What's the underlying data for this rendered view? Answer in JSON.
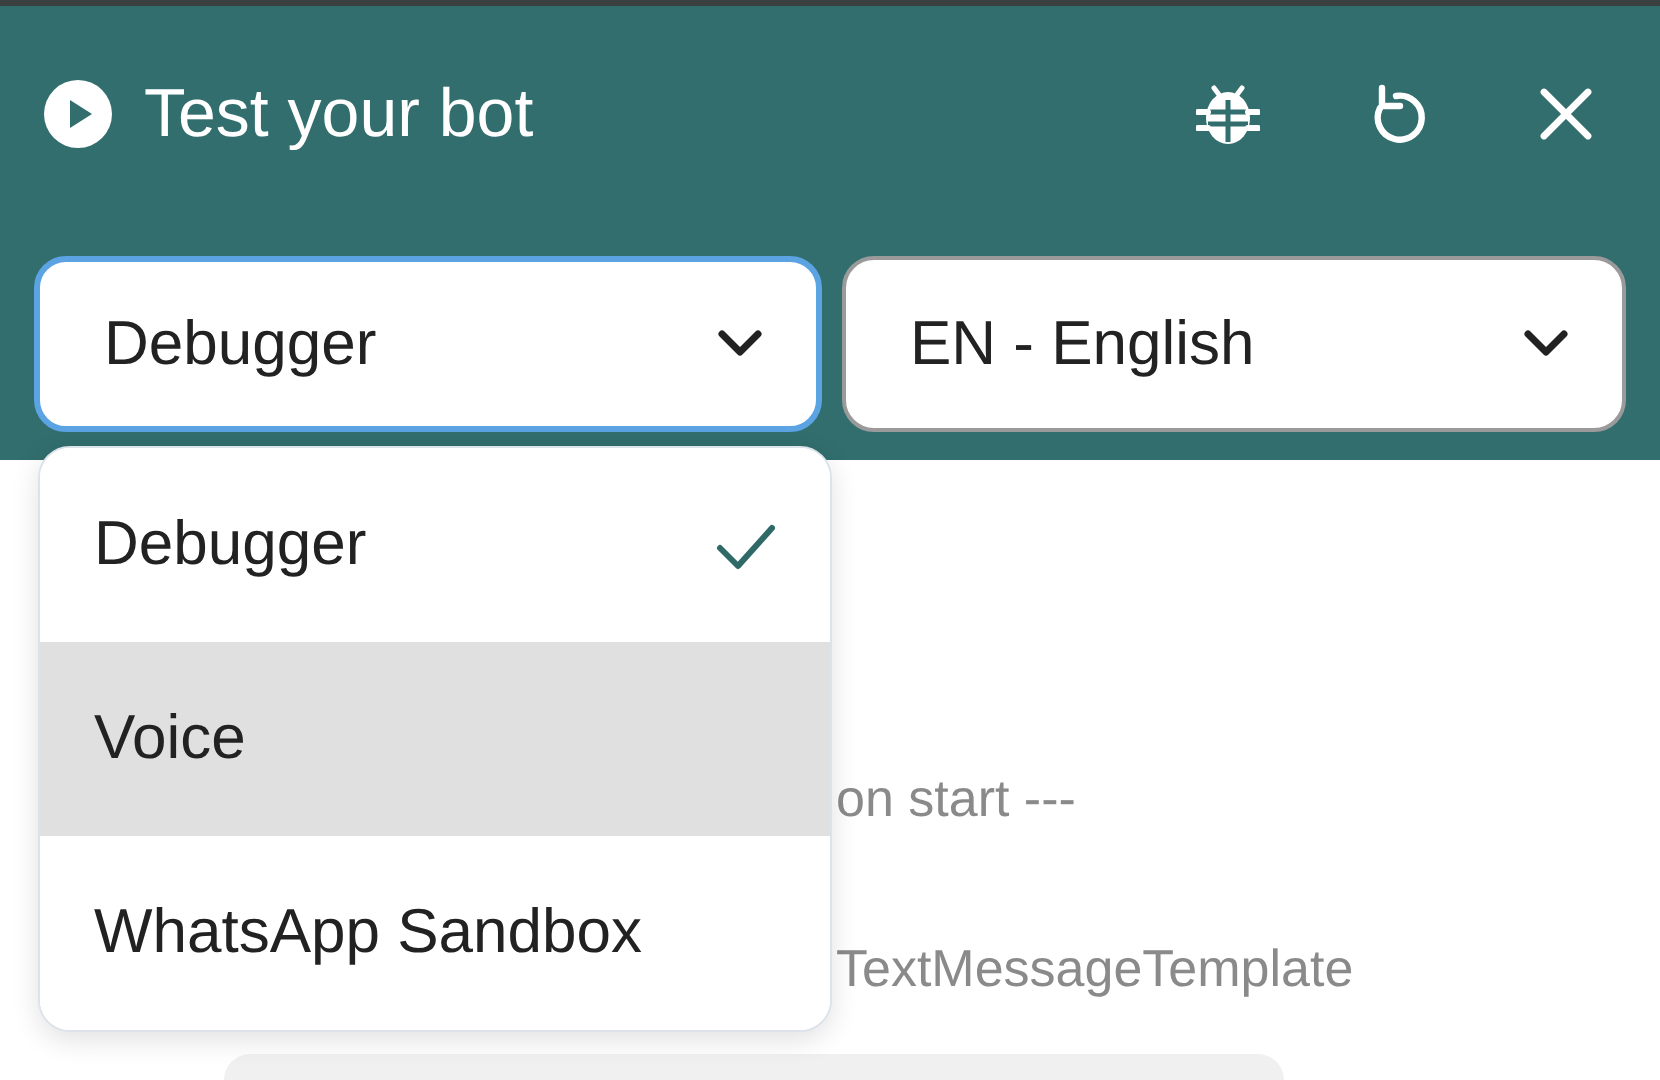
{
  "header": {
    "title": "Test your bot"
  },
  "selects": [
    {
      "value": "Debugger",
      "focused": true
    },
    {
      "value": "EN - English",
      "focused": false
    }
  ],
  "menu": {
    "items": [
      {
        "label": "Debugger",
        "selected": true,
        "highlighted": false
      },
      {
        "label": "Voice",
        "selected": false,
        "highlighted": true
      },
      {
        "label": "WhatsApp Sandbox",
        "selected": false,
        "highlighted": false
      }
    ]
  },
  "log": [
    "on start ---",
    "TextMessageTemplate"
  ]
}
